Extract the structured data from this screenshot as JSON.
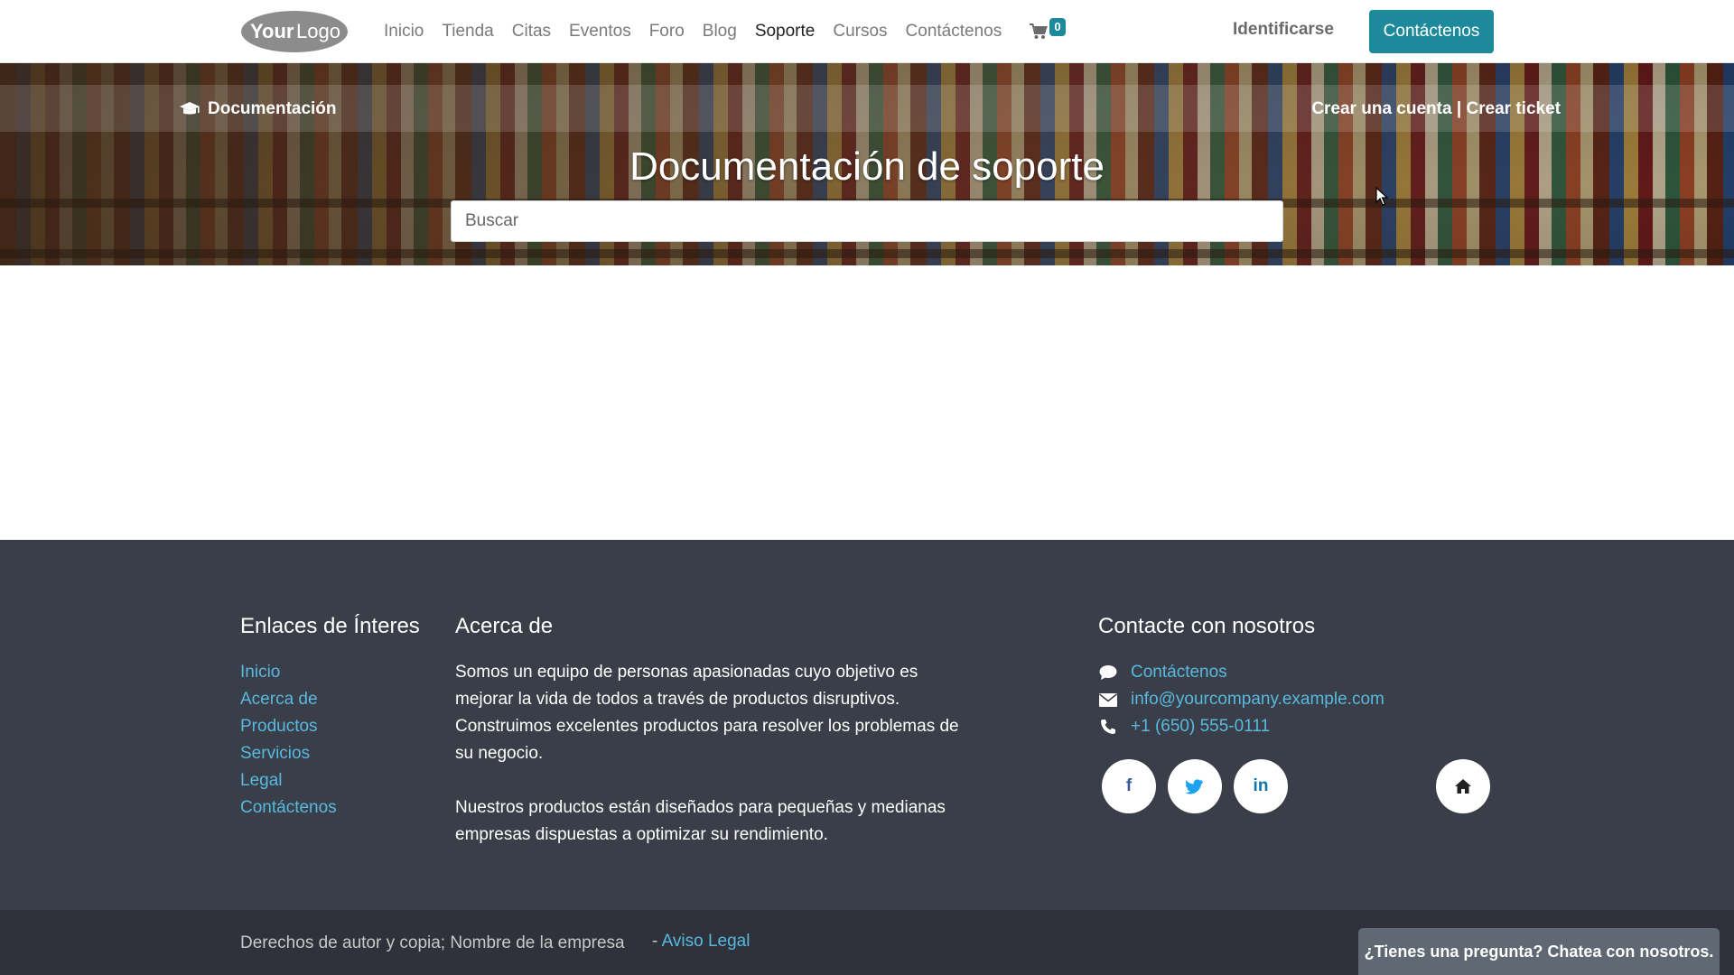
{
  "brand": {
    "logo_text": "YourLogo"
  },
  "nav": {
    "items": [
      {
        "label": "Inicio"
      },
      {
        "label": "Tienda"
      },
      {
        "label": "Citas"
      },
      {
        "label": "Eventos"
      },
      {
        "label": "Foro"
      },
      {
        "label": "Blog"
      },
      {
        "label": "Soporte",
        "active": true
      },
      {
        "label": "Cursos"
      },
      {
        "label": "Contáctenos"
      }
    ],
    "cart_count": "0",
    "login_label": "Identificarse",
    "cta_label": "Contáctenos"
  },
  "hero": {
    "docs_label": "Documentación",
    "create_account": "Crear una cuenta",
    "separator": "|",
    "create_ticket": "Crear ticket",
    "title": "Documentación de soporte",
    "search_placeholder": "Buscar"
  },
  "footer": {
    "links": {
      "title": "Enlaces de Ínteres",
      "items": [
        "Inicio",
        "Acerca de",
        "Productos",
        "Servicios",
        "Legal",
        "Contáctenos"
      ]
    },
    "about": {
      "title": "Acerca de",
      "p1": "Somos un equipo de personas apasionadas cuyo objetivo es mejorar la vida de todos a través de productos disruptivos. Construimos excelentes productos para resolver los problemas de su negocio.",
      "p2": "Nuestros productos están diseñados para pequeñas y medianas empresas dispuestas a optimizar su rendimiento."
    },
    "contact": {
      "title": "Contacte con nosotros",
      "contact_link": "Contáctenos",
      "email": "info@yourcompany.example.com",
      "phone": "+1 (650) 555-0111"
    },
    "social": {
      "facebook": "f",
      "linkedin": "in"
    }
  },
  "copyright": {
    "text": "Derechos de autor y copia; Nombre de la empresa",
    "dash": "-",
    "legal_link": "Aviso Legal"
  },
  "chat": {
    "label": "¿Tienes una pregunta? Chatea con nosotros."
  },
  "colors": {
    "accent": "#1d8a9b",
    "link": "#58b9e0",
    "footer_bg": "#3a3e48",
    "copyright_bg": "#2f323a"
  }
}
